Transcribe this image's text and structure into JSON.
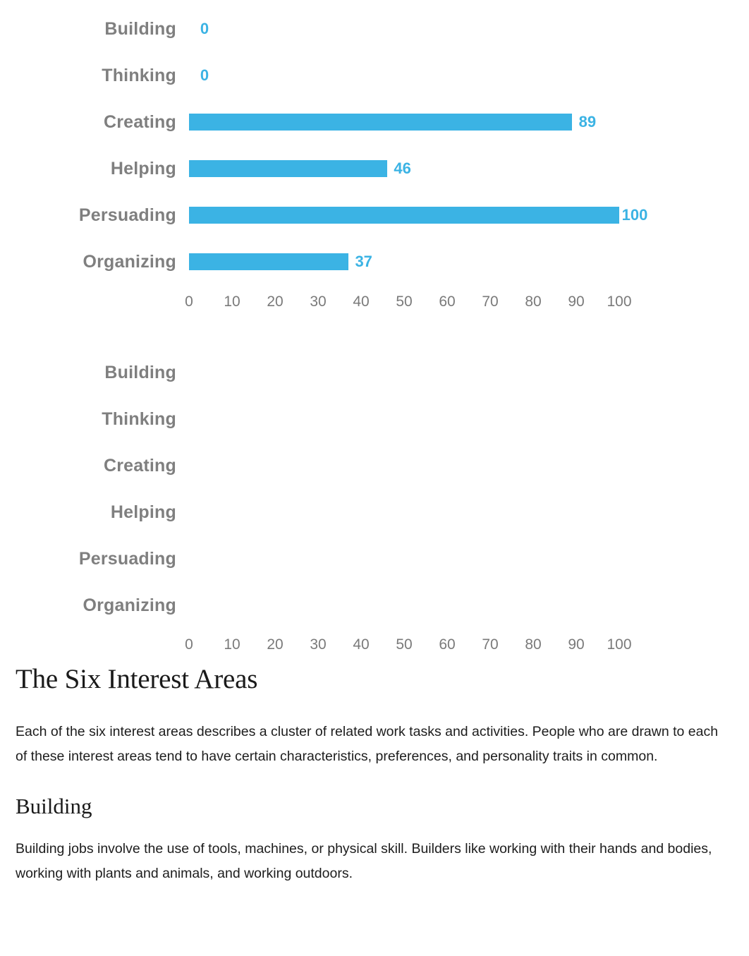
{
  "chart_data": [
    {
      "type": "bar",
      "orientation": "horizontal",
      "id": "interest-profiler-results",
      "title": "",
      "xlabel": "",
      "ylabel": "",
      "categories": [
        "Building",
        "Thinking",
        "Creating",
        "Helping",
        "Persuading",
        "Organizing"
      ],
      "values": [
        0,
        0,
        89,
        46,
        100,
        37
      ],
      "value_labels": [
        "0",
        "0",
        "89",
        "46",
        "100",
        "37"
      ],
      "xlim": [
        0,
        100
      ],
      "xticks": [
        0,
        10,
        20,
        30,
        40,
        50,
        60,
        70,
        80,
        90,
        100
      ],
      "xtick_labels": [
        "0",
        "10",
        "20",
        "30",
        "40",
        "50",
        "60",
        "70",
        "80",
        "90",
        "100"
      ],
      "grid": false,
      "legend": false,
      "bar_color": "#3bb3e4",
      "label_color": "#3bb3e4",
      "category_color": "#7f7f7f"
    },
    {
      "type": "bar",
      "orientation": "horizontal",
      "id": "interest-profiler-empty",
      "title": "",
      "xlabel": "",
      "ylabel": "",
      "categories": [
        "Building",
        "Thinking",
        "Creating",
        "Helping",
        "Persuading",
        "Organizing"
      ],
      "values": [
        null,
        null,
        null,
        null,
        null,
        null
      ],
      "value_labels": [
        "",
        "",
        "",
        "",
        "",
        ""
      ],
      "xlim": [
        0,
        100
      ],
      "xticks": [
        0,
        10,
        20,
        30,
        40,
        50,
        60,
        70,
        80,
        90,
        100
      ],
      "xtick_labels": [
        "0",
        "10",
        "20",
        "30",
        "40",
        "50",
        "60",
        "70",
        "80",
        "90",
        "100"
      ],
      "grid": false,
      "legend": false,
      "bar_color": "#3bb3e4",
      "label_color": "#3bb3e4",
      "category_color": "#7f7f7f"
    }
  ],
  "article": {
    "heading": "The Six Interest Areas",
    "intro": "Each of the six interest areas describes a cluster of related work tasks and activities. People who are drawn to each of these interest areas tend to have certain characteristics, preferences, and personality traits in common.",
    "sections": [
      {
        "heading": "Building",
        "body": "Building jobs involve the use of tools, machines, or physical skill. Builders like working with their hands and bodies, working with plants and animals, and working outdoors."
      }
    ]
  }
}
